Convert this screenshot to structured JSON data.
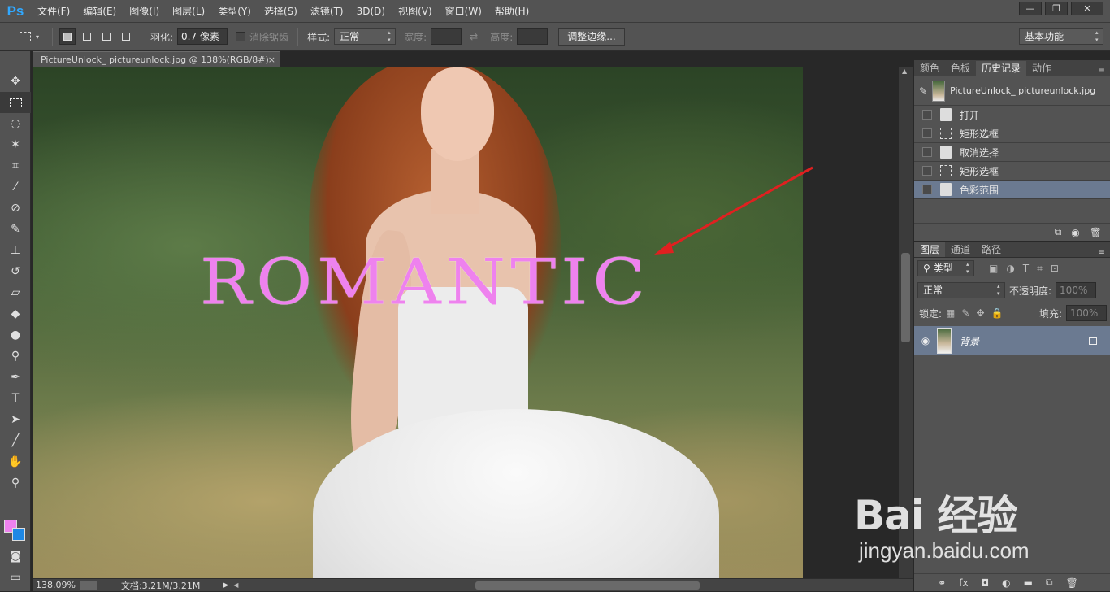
{
  "app": {
    "logo": "Ps"
  },
  "menu": [
    "文件(F)",
    "编辑(E)",
    "图像(I)",
    "图层(L)",
    "类型(Y)",
    "选择(S)",
    "滤镜(T)",
    "3D(D)",
    "视图(V)",
    "窗口(W)",
    "帮助(H)"
  ],
  "window_controls": {
    "minimize": "—",
    "restore": "❐",
    "close": "✕"
  },
  "options": {
    "feather_label": "羽化:",
    "feather_value": "0.7 像素",
    "antialias_label": "消除锯齿",
    "style_label": "样式:",
    "style_value": "正常",
    "width_label": "宽度:",
    "height_label": "高度:",
    "refine_edge": "调整边缘...",
    "workspace": "基本功能"
  },
  "document": {
    "tab_title": "PictureUnlock_ pictureunlock.jpg @ 138%(RGB/8#)",
    "tab_close": "×",
    "overlay_text": "ROMANTIC"
  },
  "status_bar": {
    "zoom": "138.09%",
    "doc_info": "文档:3.21M/3.21M"
  },
  "colors": {
    "foreground": "#ee82ee",
    "background": "#1e88e5",
    "accent": "#31a8ff",
    "selected_row": "#6b7a91",
    "annotation_arrow": "#e02020"
  },
  "history_panel": {
    "tabs": [
      "颜色",
      "色板",
      "历史记录",
      "动作"
    ],
    "active_tab": 2,
    "snapshot": "PictureUnlock_ pictureunlock.jpg",
    "steps": [
      {
        "label": "打开",
        "icon": "document-icon"
      },
      {
        "label": "矩形选框",
        "icon": "marquee-icon"
      },
      {
        "label": "取消选择",
        "icon": "document-icon"
      },
      {
        "label": "矩形选框",
        "icon": "marquee-icon"
      },
      {
        "label": "色彩范围",
        "icon": "document-icon"
      }
    ],
    "selected_step": 4
  },
  "layers_panel": {
    "tabs": [
      "图层",
      "通道",
      "路径"
    ],
    "filter_kind": "类型",
    "blend_mode": "正常",
    "opacity_label": "不透明度:",
    "opacity_value": "100%",
    "lock_label": "锁定:",
    "fill_label": "填充:",
    "fill_value": "100%",
    "layer_name": "背景"
  },
  "watermark": {
    "brand": "Bai 经验",
    "url": "jingyan.baidu.com"
  }
}
